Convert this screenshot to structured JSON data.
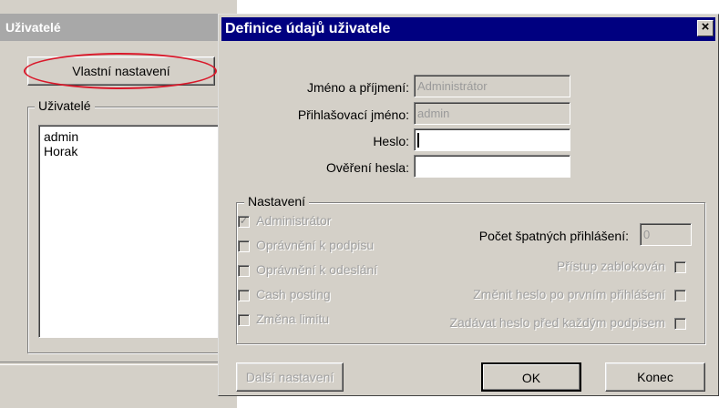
{
  "background_window": {
    "title": "Uživatelé",
    "settings_button": "Vlastní nastavení",
    "users_group_label": "Uživatelé",
    "users": [
      "admin",
      "Horak"
    ]
  },
  "dialog": {
    "title": "Definice údajů uživatele",
    "close_glyph": "×",
    "fields": {
      "full_name_label": "Jméno a příjmení:",
      "full_name_value": "Administrátor",
      "login_label": "Přihlašovací jméno:",
      "login_value": "admin",
      "password_label": "Heslo:",
      "password_value": "",
      "password_confirm_label": "Ověření hesla:",
      "password_confirm_value": ""
    },
    "settings": {
      "group_label": "Nastavení",
      "checkboxes_left": [
        {
          "label": "Administrátor",
          "checked": true
        },
        {
          "label": "Oprávnění k podpisu",
          "checked": false
        },
        {
          "label": "Oprávnění k odeslání",
          "checked": false
        },
        {
          "label": "Cash posting",
          "checked": false
        },
        {
          "label": "Změna limitu",
          "checked": false
        }
      ],
      "failed_logins_label": "Počet špatných přihlášení:",
      "failed_logins_value": "0",
      "checkboxes_right": [
        {
          "label": "Přístup zablokován",
          "checked": false
        },
        {
          "label": "Změnit heslo po prvním přihlášení",
          "checked": false
        },
        {
          "label": "Zadávat heslo před každým podpisem",
          "checked": false
        }
      ]
    },
    "buttons": {
      "more_settings": "Další nastavení",
      "ok": "OK",
      "close": "Konec"
    }
  },
  "colors": {
    "titlebar_active": "#000080",
    "titlebar_inactive": "#a8a8a8",
    "window_face": "#d4d0c8",
    "highlight_ellipse": "#d9182a"
  }
}
